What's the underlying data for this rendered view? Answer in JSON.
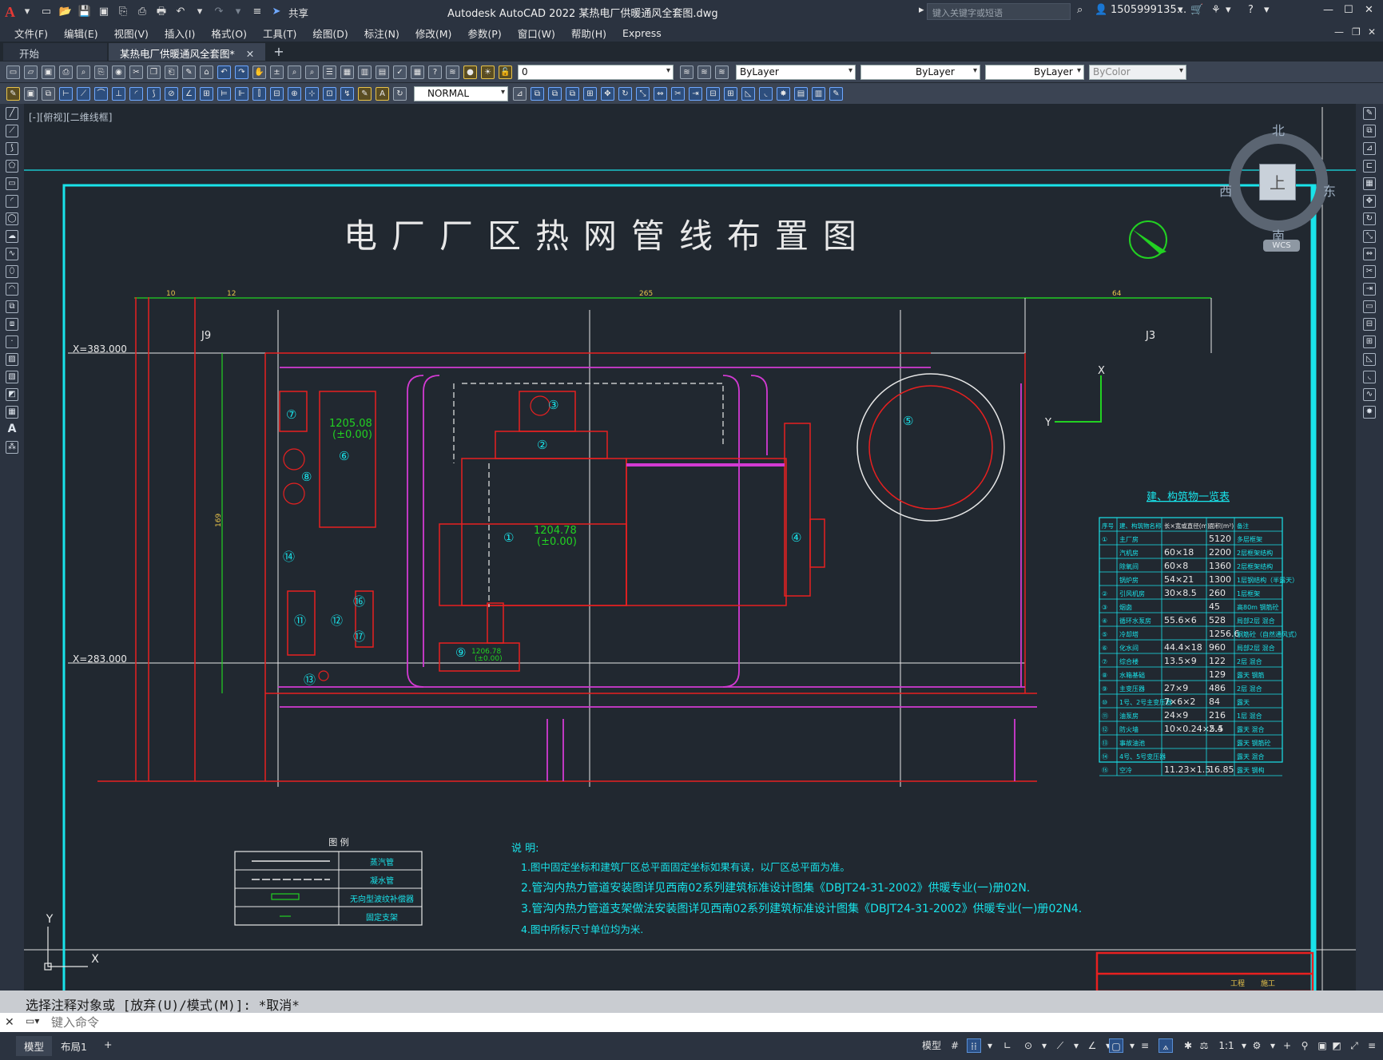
{
  "app": {
    "window_title": "Autodesk AutoCAD 2022    某热电厂供暖通风全套图.dwg",
    "share_label": "共享",
    "search_placeholder": "键入关键字或短语",
    "user": "1505999135...",
    "window_controls": [
      "—",
      "☐",
      "✕"
    ]
  },
  "menu": {
    "items": [
      "文件(F)",
      "编辑(E)",
      "视图(V)",
      "插入(I)",
      "格式(O)",
      "工具(T)",
      "绘图(D)",
      "标注(N)",
      "修改(M)",
      "参数(P)",
      "窗口(W)",
      "帮助(H)",
      "Express"
    ]
  },
  "tabs": {
    "items": [
      {
        "label": "开始",
        "active": false
      },
      {
        "label": "某热电厂供暖通风全套图*",
        "active": true
      }
    ],
    "close_icon": "✕",
    "add_icon": "+"
  },
  "toolbar": {
    "layer_value": "0",
    "color_value": "ByLayer",
    "linetype_value": "ByLayer",
    "lineweight_value": "ByLayer",
    "plotstyle_value": "ByColor",
    "dimstyle_value": "NORMAL"
  },
  "viewport": {
    "label": "[-][俯视][二维线框]",
    "viewcube": {
      "north": "北",
      "south": "南",
      "east": "东",
      "west": "西",
      "top": "上",
      "wcs": "WCS"
    }
  },
  "drawing": {
    "title": "电厂厂区热网管线布置图",
    "coord_labels": [
      "X=383.000",
      "X=283.000"
    ],
    "junction_labels": [
      "J9",
      "J3"
    ],
    "building_elevations": [
      {
        "no": "⑥",
        "elev": "1205.08",
        "rel": "(±0.00)"
      },
      {
        "no": "①",
        "elev": "1204.78",
        "rel": "(±0.00)"
      },
      {
        "no": "⑨",
        "elev": "1206.78",
        "rel": "(±0.00)"
      }
    ],
    "building_numbers": [
      "①",
      "②",
      "③",
      "④",
      "⑤",
      "⑥",
      "⑦",
      "⑧",
      "⑨",
      "⑪",
      "⑫",
      "⑬",
      "⑭",
      "⑯",
      "⑰"
    ],
    "dimensions": [
      "10",
      "12",
      "265",
      "64",
      "169"
    ],
    "axis_labels": {
      "x": "X",
      "y": "Y"
    },
    "schedule": {
      "title": "建、构筑物一览表",
      "headers": [
        "序号",
        "建、构筑物名称",
        "长×宽或直径(m)",
        "面积(m²)",
        "备注"
      ],
      "rows": [
        [
          "①",
          "主厂房",
          "",
          "5120",
          "多层框架"
        ],
        [
          "",
          "汽机房",
          "60×18",
          "2200",
          "2层框架结构"
        ],
        [
          "",
          "除氧间",
          "60×8",
          "1360",
          "2层框架结构"
        ],
        [
          "",
          "锅炉房",
          "54×21",
          "1300",
          "1层钢结构（半露天）"
        ],
        [
          "②",
          "引风机房",
          "30×8.5",
          "260",
          "1层框架"
        ],
        [
          "③",
          "烟囱",
          "",
          "45",
          "高80m 钢筋砼"
        ],
        [
          "④",
          "循环水泵房",
          "55.6×6",
          "528",
          "局部2层 混合"
        ],
        [
          "⑤",
          "冷却塔",
          "",
          "1256.6",
          "钢筋砼（自然通风式）"
        ],
        [
          "⑥",
          "化水间",
          "44.4×18",
          "960",
          "局部2层 混合"
        ],
        [
          "⑦",
          "综合楼",
          "13.5×9",
          "122",
          "2层 混合"
        ],
        [
          "⑧",
          "水箱基础",
          "",
          "129",
          "露天 钢筋"
        ],
        [
          "⑨",
          "主变压器",
          "27×9",
          "486",
          "2层 混合"
        ],
        [
          "⑩",
          "1号、2号主变压器",
          "7×6×2",
          "84",
          "露天"
        ],
        [
          "⑪",
          "油泵房",
          "24×9",
          "216",
          "1层 混合"
        ],
        [
          "⑫",
          "防火墙",
          "10×0.24×5.5",
          "2.4",
          "露天 混合"
        ],
        [
          "⑬",
          "事故油池",
          "",
          "",
          "露天 钢筋砼"
        ],
        [
          "⑭",
          "4号、5号变压器",
          "",
          "",
          "露天 混合"
        ],
        [
          "⑮",
          "空冷",
          "11.23×1.5",
          "16.85",
          "露天 钢构"
        ]
      ]
    },
    "legend": {
      "title": "图 例",
      "items": [
        "蒸汽管",
        "凝水管",
        "无向型波纹补偿器",
        "固定支架"
      ]
    },
    "notes": {
      "title": "说 明:",
      "items": [
        "1.图中固定坐标和建筑厂区总平面固定坐标如果有误，以厂区总平面为准。",
        "2.管沟内热力管道安装图详见西南02系列建筑标准设计图集《DBJT24-31-2002》供暖专业(一)册02N.",
        "3.管沟内热力管道支架做法安装图详见西南02系列建筑标准设计图集《DBJT24-31-2002》供暖专业(一)册02N4."
      ],
      "item4": "4.图中所标尺寸单位均为米."
    },
    "title_block": [
      "工程",
      "施工"
    ]
  },
  "command": {
    "history": "选择注释对象或 [放弃(U)/模式(M)]: *取消*",
    "placeholder": "键入命令"
  },
  "status": {
    "layout_tabs": [
      "模型",
      "布局1"
    ],
    "add_icon": "+",
    "model_label": "模型",
    "scale": "1:1"
  }
}
